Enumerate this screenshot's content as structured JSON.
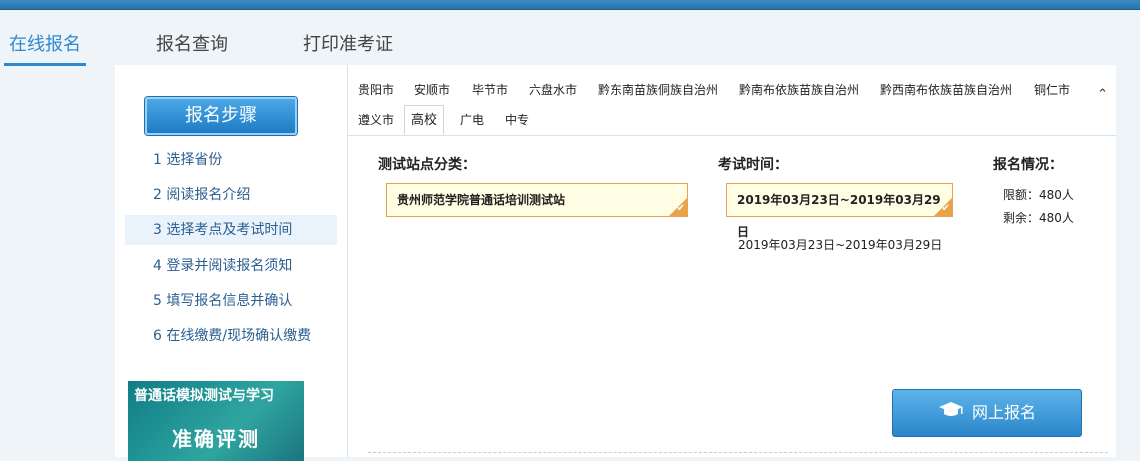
{
  "nav": {
    "tabs": [
      {
        "label": "在线报名"
      },
      {
        "label": "报名查询"
      },
      {
        "label": "打印准考证"
      }
    ]
  },
  "sidebar": {
    "title": "报名步骤",
    "steps": [
      {
        "label": "1 选择省份"
      },
      {
        "label": "2 阅读报名介绍"
      },
      {
        "label": "3 选择考点及考试时间"
      },
      {
        "label": "4 登录并阅读报名须知"
      },
      {
        "label": "5 填写报名信息并确认"
      },
      {
        "label": "6 在线缴费/现场确认缴费"
      }
    ],
    "ad": {
      "line1": "普通话模拟测试与学习",
      "line2": "准确评测"
    }
  },
  "cities": {
    "row1": [
      "贵阳市",
      "安顺市",
      "毕节市",
      "六盘水市",
      "黔东南苗族侗族自治州",
      "黔南布依族苗族自治州",
      "黔西南布依族苗族自治州",
      "铜仁市"
    ],
    "row2": [
      "遵义市",
      "高校",
      "广电",
      "中专"
    ],
    "active": "高校"
  },
  "form": {
    "site_label": "测试站点分类：",
    "site_value": "贵州师范学院普通话培训测试站",
    "time_label": "考试时间：",
    "time_value": "2019年03月23日~2019年03月29日",
    "time_option": "2019年03月23日~2019年03月29日",
    "status_label": "报名情况：",
    "quota": "限额：480人",
    "remaining": "剩余：480人"
  },
  "apply_button": "网上报名",
  "colors": {
    "accent": "#2e8ad0",
    "selected_border": "#e8a24a",
    "selected_bg": "#fffde4"
  }
}
